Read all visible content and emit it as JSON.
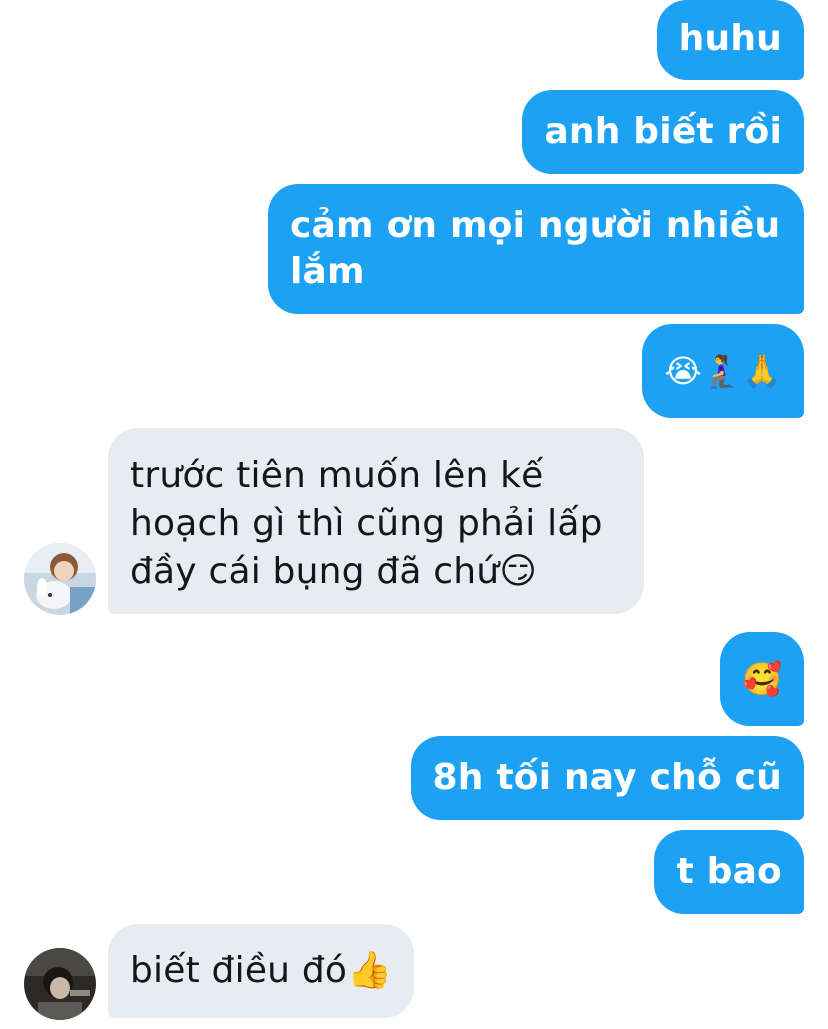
{
  "conversation": {
    "messages": [
      {
        "sender": "me",
        "text": "huhu"
      },
      {
        "sender": "me",
        "text": "anh biết rồi"
      },
      {
        "sender": "me",
        "lines": [
          "cảm ơn mọi người nhiều",
          "lắm"
        ]
      },
      {
        "sender": "me",
        "text": "😭🧎‍♀️🙏"
      },
      {
        "sender": "other",
        "lines": [
          "trước tiên muốn lên kế",
          "hoạch gì thì cũng phải lấp",
          "đầy cái bụng đã chứ😏"
        ]
      },
      {
        "sender": "me",
        "text": "🥰"
      },
      {
        "sender": "me",
        "text": "8h tối nay chỗ cũ"
      },
      {
        "sender": "me",
        "text": "t bao"
      },
      {
        "sender": "other",
        "text": "biết điều đó👍"
      }
    ]
  },
  "colors": {
    "sent_bubble": "#1da1f2",
    "received_bubble": "#e6ecf0",
    "sent_text": "#ffffff",
    "received_text": "#14171a"
  }
}
